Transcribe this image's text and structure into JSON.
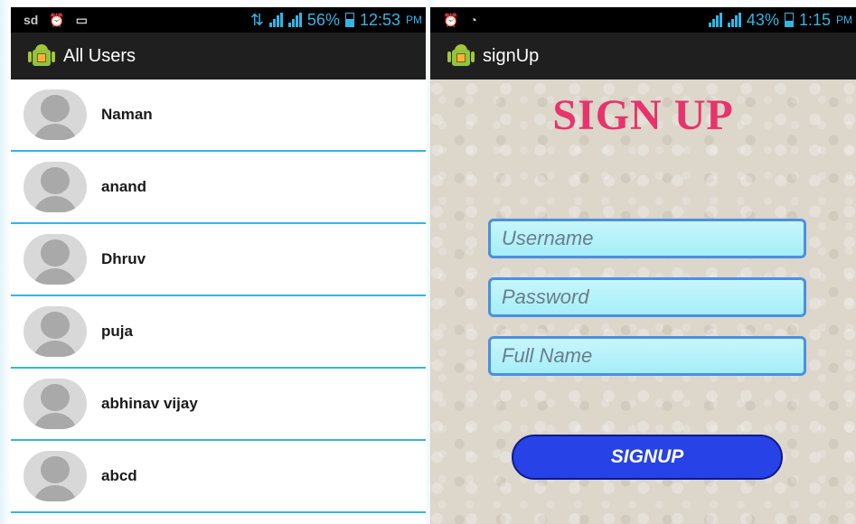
{
  "left_screen": {
    "status": {
      "carrier": "sd",
      "battery": "56%",
      "time": "12:53",
      "ampm": "PM",
      "battery_color": "#33b5e5"
    },
    "title": "All Users",
    "users": [
      {
        "name": "Naman"
      },
      {
        "name": "anand"
      },
      {
        "name": "Dhruv"
      },
      {
        "name": "puja"
      },
      {
        "name": "abhinav vijay"
      },
      {
        "name": "abcd"
      }
    ]
  },
  "right_screen": {
    "status": {
      "battery": "43%",
      "time": "1:15",
      "ampm": "PM"
    },
    "title": "signUp",
    "heading": "SIGN UP",
    "username_placeholder": "Username",
    "password_placeholder": "Password",
    "fullname_placeholder": "Full Name",
    "button_label": "SIGNUP",
    "heading_color": "#e8336b",
    "button_color": "#2742e6"
  },
  "icons": [
    "alarm-icon",
    "image-icon",
    "wifi-icon",
    "signal-icon",
    "battery-icon",
    "android-app-icon",
    "avatar-icon"
  ]
}
